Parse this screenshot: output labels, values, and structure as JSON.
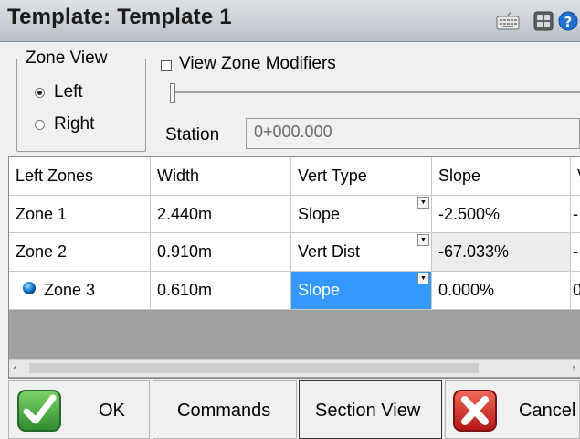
{
  "window": {
    "title": "Template: Template 1"
  },
  "zone_view": {
    "legend": "Zone View",
    "options": [
      {
        "label": "Left",
        "selected": true
      },
      {
        "label": "Right",
        "selected": false
      }
    ]
  },
  "view_zone_modifiers": {
    "label": "View Zone Modifiers",
    "checked": false
  },
  "station": {
    "label": "Station",
    "value": "0+000.000"
  },
  "grid": {
    "columns": [
      "Left Zones",
      "Width",
      "Vert Type",
      "Slope",
      "V"
    ],
    "rows": [
      {
        "zone": "Zone 1",
        "width": "2.440m",
        "vert_type": "Slope",
        "slope": "-2.500%",
        "extra": "-"
      },
      {
        "zone": "Zone 2",
        "width": "0.910m",
        "vert_type": "Vert Dist",
        "slope": "-67.033%",
        "extra": "-"
      },
      {
        "zone": "Zone 3",
        "width": "0.610m",
        "vert_type": "Slope",
        "slope": "0.000%",
        "extra": "0"
      }
    ],
    "active_row_icon": "blue-circle-icon",
    "selected_cell": "Zone 3 / Vert Type"
  },
  "buttons": {
    "ok": "OK",
    "commands": "Commands",
    "section_view": "Section View",
    "cancel": "Cancel"
  },
  "colors": {
    "selection": "#3399ff",
    "ok_green": "#3aa53a",
    "cancel_red": "#d62020"
  }
}
